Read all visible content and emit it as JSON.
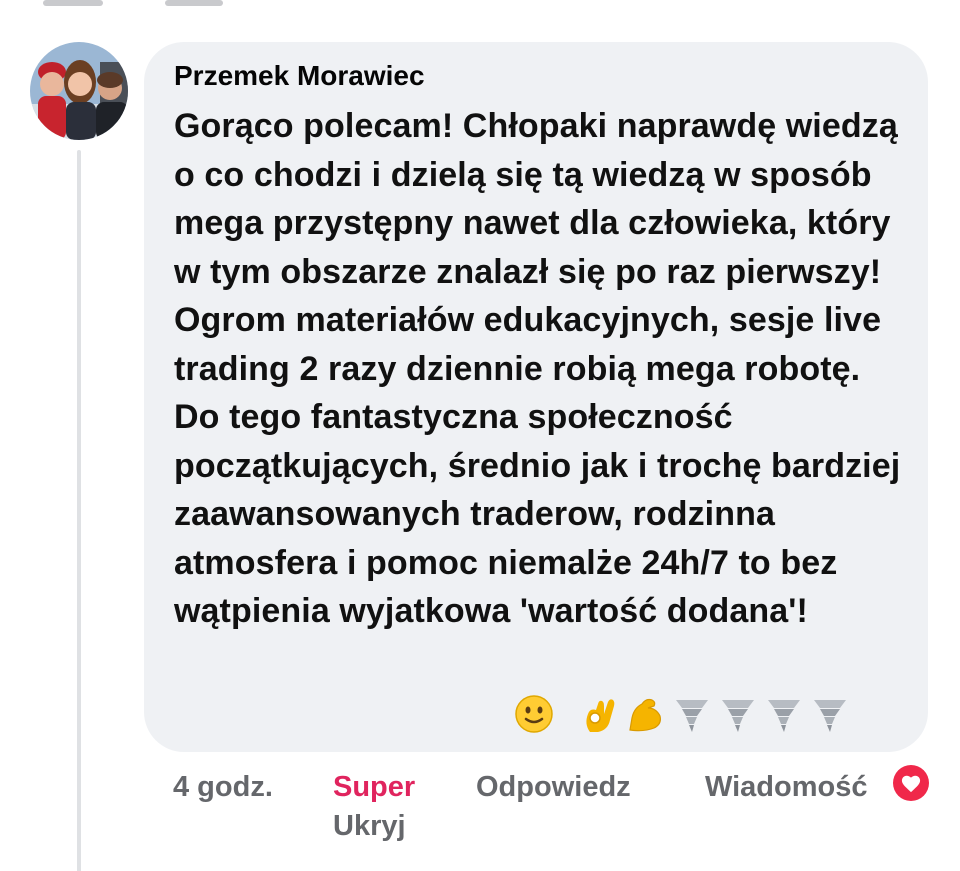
{
  "comment": {
    "author": "Przemek Morawiec",
    "text": "Gorąco polecam! Chłopaki naprawdę wiedzą o co chodzi i dzielą się tą wiedzą w sposób mega przystępny nawet dla człowieka, który w tym obszarze znalazł się po raz pierwszy! Ogrom materiałów edukacyjnych, sesje live trading 2 razy dziennie robią mega robotę. Do tego fantastyczna społeczność początkujących, średnio jak i trochę bardziej zaawansowanych traderow, rodzinna atmosfera i pomoc niemalże 24h/7 to bez wątpienia wyjatkowa 'wartość dodana'!",
    "emojis": [
      "slightly-smiling-face",
      "ok-hand",
      "flexed-biceps",
      "tornado",
      "tornado",
      "tornado",
      "tornado"
    ]
  },
  "actions": {
    "time": "4 godz.",
    "reaction": "Super",
    "reply": "Odpowiedz",
    "message": "Wiadomość",
    "hide": "Ukryj"
  },
  "reaction_badge": {
    "icon": "heart-icon",
    "color": "#f0284a"
  },
  "colors": {
    "bubble": "#eff1f4",
    "meta": "#65676b",
    "super": "#e0245e"
  }
}
